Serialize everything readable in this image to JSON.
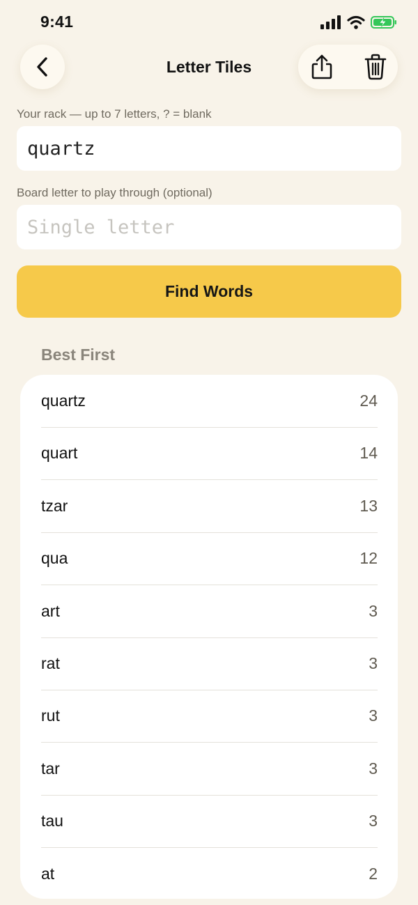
{
  "status_bar": {
    "time": "9:41"
  },
  "nav": {
    "title": "Letter Tiles"
  },
  "rack": {
    "label": "Your rack — up to 7 letters, ? = blank",
    "value": "quartz"
  },
  "board": {
    "label": "Board letter to play through (optional)",
    "placeholder": "Single letter",
    "value": ""
  },
  "actions": {
    "find_label": "Find Words"
  },
  "results": {
    "section_title": "Best First",
    "items": [
      {
        "word": "quartz",
        "score": "24"
      },
      {
        "word": "quart",
        "score": "14"
      },
      {
        "word": "tzar",
        "score": "13"
      },
      {
        "word": "qua",
        "score": "12"
      },
      {
        "word": "art",
        "score": "3"
      },
      {
        "word": "rat",
        "score": "3"
      },
      {
        "word": "rut",
        "score": "3"
      },
      {
        "word": "tar",
        "score": "3"
      },
      {
        "word": "tau",
        "score": "3"
      },
      {
        "word": "at",
        "score": "2"
      }
    ]
  },
  "colors": {
    "accent": "#f6c94a",
    "background": "#f8f3e9",
    "battery": "#34c759"
  }
}
